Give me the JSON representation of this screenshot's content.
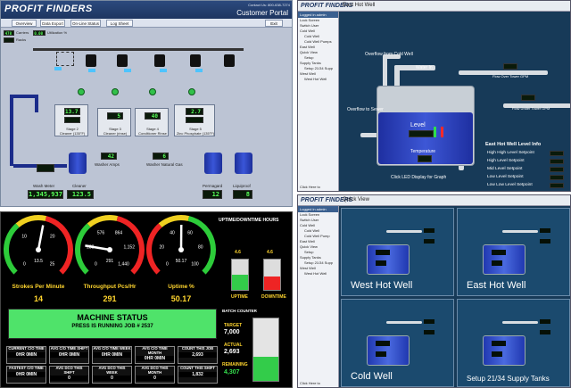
{
  "panel1": {
    "logo": "PROFIT FINDERS",
    "contact": "Contact Us: 800-638-7274",
    "portal": "Customer Portal",
    "tabs": [
      "Overview",
      "Data Export",
      "On-Line Status",
      "Log Sheet"
    ],
    "exit": "Exit",
    "left_labels": [
      "Carriers",
      "Racks",
      "Utilization %"
    ],
    "left_values": [
      "478",
      "0.00"
    ],
    "stations": [
      {
        "value": "13.7",
        "label": "Stage 2\nCleaner (135°F)"
      },
      {
        "value": "5",
        "label": "Stage 3\nCleaner (rinse)"
      },
      {
        "value": "40",
        "label": "Stage 4\nConditioner Rinse"
      },
      {
        "value": "2.7",
        "label": "Stage 5\nZinc Phosphate (135°F)"
      }
    ],
    "bottom_labels": [
      "Wash Meter",
      "Cleaner",
      "Washer Amps",
      "Washer Natural Gas",
      "Permagard",
      "Liquiproof"
    ],
    "bottom_values": [
      "1,345,937",
      "123.5",
      "42",
      "6",
      "12",
      "8"
    ]
  },
  "panel2": {
    "logo": "PROFIT FINDERS",
    "title": "East Hot Well",
    "sidebar_title": "Logged in admin",
    "sidebar": [
      {
        "t": "Lock Screen",
        "lvl": 1
      },
      {
        "t": "Switch User",
        "lvl": 1
      },
      {
        "t": "Cold Well",
        "lvl": 1
      },
      {
        "t": "Cold Well",
        "lvl": 2
      },
      {
        "t": "Cold Well Pumps",
        "lvl": 2
      },
      {
        "t": "East Well",
        "lvl": 1
      },
      {
        "t": "Quick View",
        "lvl": 1
      },
      {
        "t": "Setup",
        "lvl": 2
      },
      {
        "t": "Supply Tanks",
        "lvl": 1
      },
      {
        "t": "Setup 21/34 Supp",
        "lvl": 2
      },
      {
        "t": "West Well",
        "lvl": 1
      },
      {
        "t": "West Hot Well",
        "lvl": 2
      }
    ],
    "labels": {
      "overflow_cold": "Overflow from Cold Well",
      "water_in": "Water In",
      "overflow_sewer": "Overflow to Sewer",
      "level": "Level",
      "temperature": "Temperature",
      "flow_over": "Flow Over Tower GPM",
      "flow_under": "Flow Under Tower GPM",
      "click_led": "Click LED Display for Graph",
      "info_title": "East Hot Well Level Info",
      "click_here": "Click Here to"
    },
    "setpoints": [
      "High High Level Setpoint",
      "High Level Setpoint",
      "Mid Level Setpoint",
      "Low Level Setpoint",
      "Low Low Level Setpoint"
    ]
  },
  "panel3": {
    "gauges": [
      {
        "title": "Strokes Per Minute",
        "value": "14",
        "needle": "13.5",
        "ticks": [
          "10",
          "20",
          "0",
          "25"
        ]
      },
      {
        "title": "Throughput Pcs/Hr",
        "value": "291",
        "needle": "291",
        "ticks": [
          "576",
          "864",
          "288",
          "1,152",
          "0",
          "1,440"
        ]
      },
      {
        "title": "Uptime %",
        "value": "50.17",
        "needle": "50.17",
        "ticks": [
          "40",
          "60",
          "20",
          "80",
          "0",
          "100"
        ]
      }
    ],
    "updown_title": "UPTIME/DOWNTIME HOURS",
    "uptime_value": "4.6",
    "downtime_value": "4.6",
    "uptime_label": "UPTIME",
    "downtime_label": "DOWNTIME",
    "uptime_fraction": 0.5,
    "downtime_fraction": 0.45,
    "machine_status_title": "MACHINE STATUS",
    "machine_status_text": "PRESS IS RUNNING JOB # 2537",
    "batch_title": "BATCH COUNTER",
    "target_label": "TARGET",
    "target_value": "7,000",
    "actual_label": "ACTUAL",
    "actual_value": "2,693",
    "remaining_label": "REMAINING",
    "remaining_value": "4,307",
    "batch_fraction": 0.38,
    "cells_row1": [
      {
        "h": "CURRENT C/O TIME",
        "v": "0HR   0MIN"
      },
      {
        "h": "AVG C/O TIME SHIFT",
        "v": "0HR   0MIN"
      },
      {
        "h": "AVG C/O TIME WEEK",
        "v": "0HR   0MIN"
      },
      {
        "h": "AVG C/O TIME MONTH",
        "v": "0HR   0MIN"
      },
      {
        "h": "COUNT THIS JOB",
        "v": "2,693"
      }
    ],
    "cells_row2": [
      {
        "h": "FASTEST C/O TIME",
        "v": "0HR   0MIN"
      },
      {
        "h": "AVG DCO THIS SHIFT",
        "v": "0"
      },
      {
        "h": "AVG DCO THIS WEEK",
        "v": "0"
      },
      {
        "h": "AVG DCO THIS MONTH",
        "v": "0"
      },
      {
        "h": "COUNT THIS SHIFT",
        "v": "1,832"
      }
    ]
  },
  "panel4": {
    "logo": "PROFIT FINDERS",
    "title": "Quick View",
    "sidebar_title": "Logged in admin",
    "sidebar": [
      {
        "t": "Lock Screen",
        "lvl": 1
      },
      {
        "t": "Switch User",
        "lvl": 1
      },
      {
        "t": "Cold Well",
        "lvl": 1
      },
      {
        "t": "Cold Well",
        "lvl": 2
      },
      {
        "t": "Cold Well Pump",
        "lvl": 2
      },
      {
        "t": "East Well",
        "lvl": 1
      },
      {
        "t": "Quick View",
        "lvl": 1
      },
      {
        "t": "Setup",
        "lvl": 2
      },
      {
        "t": "Supply Tanks",
        "lvl": 1
      },
      {
        "t": "Setup 21/34 Supp",
        "lvl": 2
      },
      {
        "t": "West Well",
        "lvl": 1
      },
      {
        "t": "West Hot Well",
        "lvl": 2
      }
    ],
    "quads": [
      "West Hot Well",
      "East Hot Well",
      "Cold Well",
      "Setup 21/34 Supply Tanks"
    ],
    "click_here": "Click Here to"
  }
}
